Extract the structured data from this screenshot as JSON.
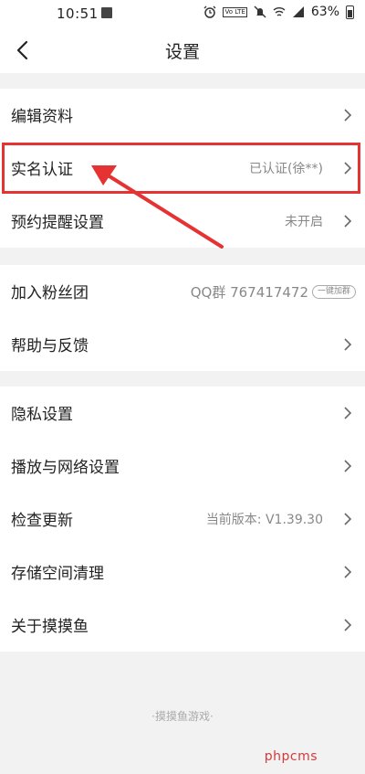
{
  "status_bar": {
    "time": "10:51",
    "network": "4G",
    "battery_percent": "63%"
  },
  "header": {
    "title": "设置",
    "back_icon": "chevron-left-icon"
  },
  "groups": [
    {
      "items": [
        {
          "label": "编辑资料",
          "value": "",
          "chevron": true
        },
        {
          "label": "实名认证",
          "value": "已认证(徐**)",
          "chevron": true
        },
        {
          "label": "预约提醒设置",
          "value": "未开启",
          "chevron": true
        }
      ]
    },
    {
      "items": [
        {
          "label": "加入粉丝团",
          "value": "QQ群 767417472",
          "pill": "一键加群"
        },
        {
          "label": "帮助与反馈",
          "value": "",
          "chevron": true
        }
      ]
    },
    {
      "items": [
        {
          "label": "隐私设置",
          "value": "",
          "chevron": true
        },
        {
          "label": "播放与网络设置",
          "value": "",
          "chevron": true
        },
        {
          "label": "检查更新",
          "value": "当前版本: V1.39.30",
          "chevron": true
        },
        {
          "label": "存储空间清理",
          "value": "",
          "chevron": true
        },
        {
          "label": "关于摸摸鱼",
          "value": "",
          "chevron": true
        }
      ]
    }
  ],
  "footer": {
    "text": "·摸摸鱼游戏·"
  },
  "watermark": "phpcms",
  "colors": {
    "highlight": "#e53333",
    "secondary_text": "#888888",
    "page_background": "#f2f2f2"
  }
}
